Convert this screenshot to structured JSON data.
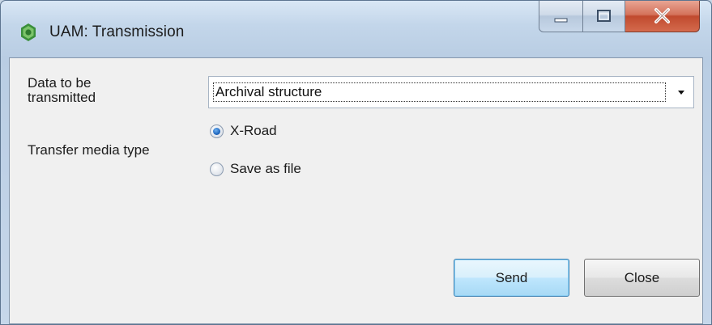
{
  "window": {
    "title": "UAM: Transmission",
    "app_icon": "green-gear-icon",
    "caption_buttons": [
      "minimize-icon",
      "maximize-icon",
      "close-icon"
    ]
  },
  "form": {
    "data_label": "Data to be transmitted",
    "data_value": "Archival structure",
    "media_label": "Transfer media type",
    "media_options": [
      {
        "label": "X-Road",
        "checked": true
      },
      {
        "label": "Save as file",
        "checked": false
      }
    ]
  },
  "buttons": {
    "send": "Send",
    "close": "Close"
  },
  "colors": {
    "accent": "#3c7fb1",
    "close_button": "#c04a2e",
    "client_bg": "#f0f0f0"
  }
}
